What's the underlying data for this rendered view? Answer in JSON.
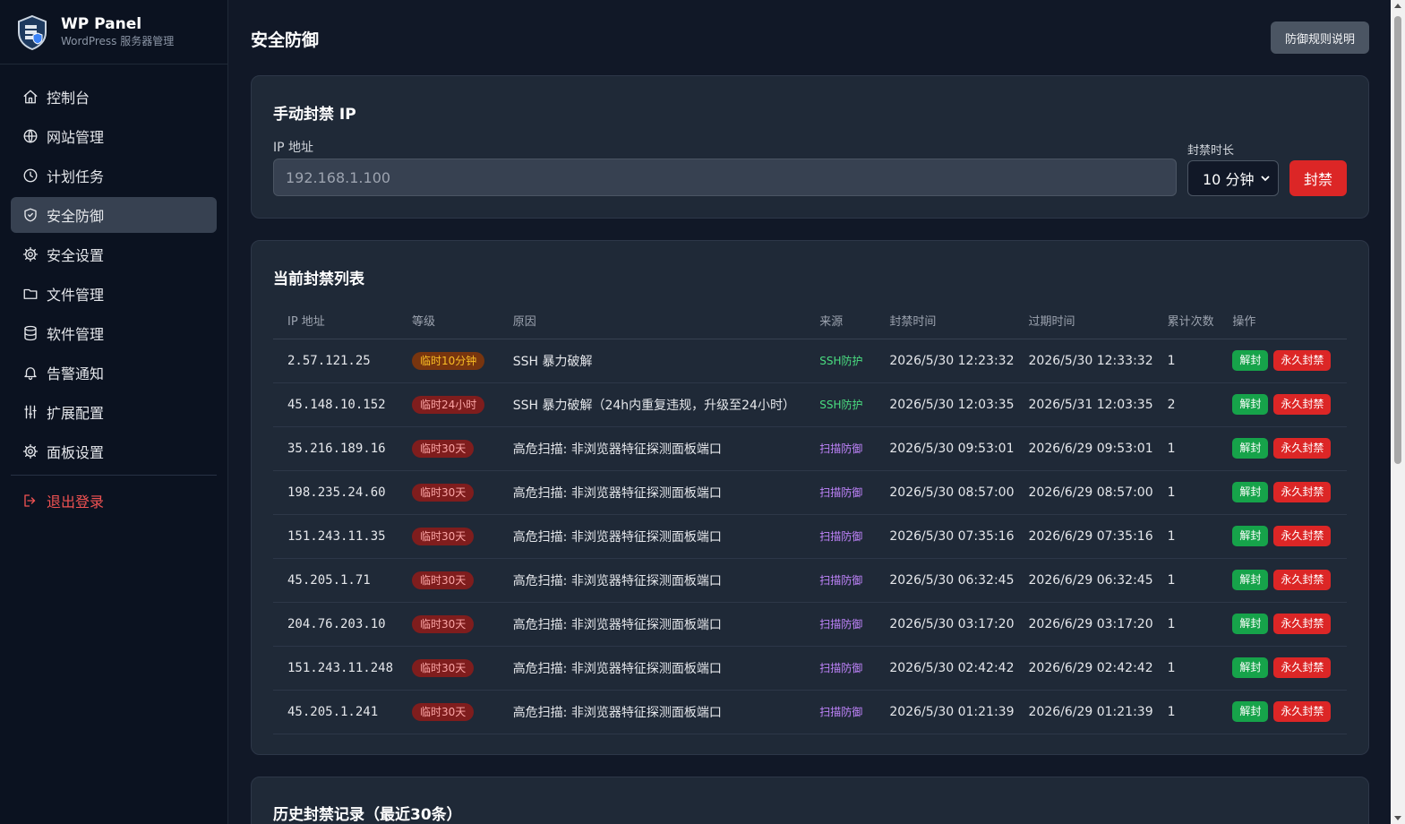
{
  "brand": {
    "title": "WP Panel",
    "subtitle": "WordPress 服务器管理"
  },
  "sidebar": {
    "items": [
      {
        "label": "控制台",
        "icon": "home-icon",
        "active": false
      },
      {
        "label": "网站管理",
        "icon": "globe-icon",
        "active": false
      },
      {
        "label": "计划任务",
        "icon": "clock-icon",
        "active": false
      },
      {
        "label": "安全防御",
        "icon": "shield-icon",
        "active": true
      },
      {
        "label": "安全设置",
        "icon": "gear-icon",
        "active": false
      },
      {
        "label": "文件管理",
        "icon": "folder-icon",
        "active": false
      },
      {
        "label": "软件管理",
        "icon": "database-icon",
        "active": false
      },
      {
        "label": "告警通知",
        "icon": "bell-icon",
        "active": false
      },
      {
        "label": "扩展配置",
        "icon": "sliders-icon",
        "active": false
      },
      {
        "label": "面板设置",
        "icon": "gear-icon",
        "active": false
      }
    ],
    "logout": {
      "label": "退出登录",
      "icon": "logout-icon"
    }
  },
  "header": {
    "title": "安全防御",
    "rules_button": "防御规则说明"
  },
  "manual_ban": {
    "title": "手动封禁 IP",
    "ip_label": "IP 地址",
    "ip_placeholder": "192.168.1.100",
    "ip_value": "",
    "duration_label": "封禁时长",
    "duration_selected": "10 分钟",
    "ban_button": "封禁"
  },
  "ban_list": {
    "title": "当前封禁列表",
    "columns": [
      "IP 地址",
      "等级",
      "原因",
      "来源",
      "封禁时间",
      "过期时间",
      "累计次数",
      "操作"
    ],
    "unban_label": "解封",
    "perm_label": "永久封禁",
    "rows": [
      {
        "ip": "2.57.121.25",
        "level": "临时10分钟",
        "level_color": "amber",
        "reason": "SSH 暴力破解",
        "source": "SSH防护",
        "source_color": "green",
        "banned_at": "2026/5/30 12:23:32",
        "expires_at": "2026/5/30 12:33:32",
        "count": "1"
      },
      {
        "ip": "45.148.10.152",
        "level": "临时24小时",
        "level_color": "red",
        "reason": "SSH 暴力破解（24h内重复违规，升级至24小时）",
        "source": "SSH防护",
        "source_color": "green",
        "banned_at": "2026/5/30 12:03:35",
        "expires_at": "2026/5/31 12:03:35",
        "count": "2"
      },
      {
        "ip": "35.216.189.16",
        "level": "临时30天",
        "level_color": "red",
        "reason": "高危扫描: 非浏览器特征探测面板端口",
        "source": "扫描防御",
        "source_color": "purple",
        "banned_at": "2026/5/30 09:53:01",
        "expires_at": "2026/6/29 09:53:01",
        "count": "1"
      },
      {
        "ip": "198.235.24.60",
        "level": "临时30天",
        "level_color": "red",
        "reason": "高危扫描: 非浏览器特征探测面板端口",
        "source": "扫描防御",
        "source_color": "purple",
        "banned_at": "2026/5/30 08:57:00",
        "expires_at": "2026/6/29 08:57:00",
        "count": "1"
      },
      {
        "ip": "151.243.11.35",
        "level": "临时30天",
        "level_color": "red",
        "reason": "高危扫描: 非浏览器特征探测面板端口",
        "source": "扫描防御",
        "source_color": "purple",
        "banned_at": "2026/5/30 07:35:16",
        "expires_at": "2026/6/29 07:35:16",
        "count": "1"
      },
      {
        "ip": "45.205.1.71",
        "level": "临时30天",
        "level_color": "red",
        "reason": "高危扫描: 非浏览器特征探测面板端口",
        "source": "扫描防御",
        "source_color": "purple",
        "banned_at": "2026/5/30 06:32:45",
        "expires_at": "2026/6/29 06:32:45",
        "count": "1"
      },
      {
        "ip": "204.76.203.10",
        "level": "临时30天",
        "level_color": "red",
        "reason": "高危扫描: 非浏览器特征探测面板端口",
        "source": "扫描防御",
        "source_color": "purple",
        "banned_at": "2026/5/30 03:17:20",
        "expires_at": "2026/6/29 03:17:20",
        "count": "1"
      },
      {
        "ip": "151.243.11.248",
        "level": "临时30天",
        "level_color": "red",
        "reason": "高危扫描: 非浏览器特征探测面板端口",
        "source": "扫描防御",
        "source_color": "purple",
        "banned_at": "2026/5/30 02:42:42",
        "expires_at": "2026/6/29 02:42:42",
        "count": "1"
      },
      {
        "ip": "45.205.1.241",
        "level": "临时30天",
        "level_color": "red",
        "reason": "高危扫描: 非浏览器特征探测面板端口",
        "source": "扫描防御",
        "source_color": "purple",
        "banned_at": "2026/5/30 01:21:39",
        "expires_at": "2026/6/29 01:21:39",
        "count": "1"
      }
    ]
  },
  "history": {
    "title": "历史封禁记录（最近30条）"
  },
  "colors": {
    "accent_red": "#dc2626",
    "accent_green": "#16a34a",
    "source_green": "#4ade80",
    "source_purple": "#c084fc",
    "level_amber": "#fbbf24"
  }
}
